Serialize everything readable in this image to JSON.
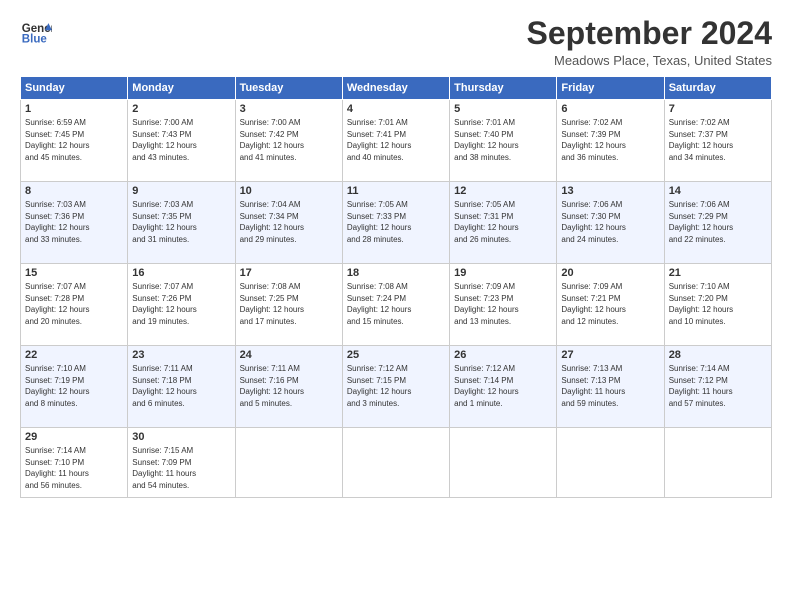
{
  "header": {
    "logo_line1": "General",
    "logo_line2": "Blue",
    "title": "September 2024",
    "location": "Meadows Place, Texas, United States"
  },
  "columns": [
    "Sunday",
    "Monday",
    "Tuesday",
    "Wednesday",
    "Thursday",
    "Friday",
    "Saturday"
  ],
  "weeks": [
    [
      {
        "day": "1",
        "info": "Sunrise: 6:59 AM\nSunset: 7:45 PM\nDaylight: 12 hours\nand 45 minutes."
      },
      {
        "day": "2",
        "info": "Sunrise: 7:00 AM\nSunset: 7:43 PM\nDaylight: 12 hours\nand 43 minutes."
      },
      {
        "day": "3",
        "info": "Sunrise: 7:00 AM\nSunset: 7:42 PM\nDaylight: 12 hours\nand 41 minutes."
      },
      {
        "day": "4",
        "info": "Sunrise: 7:01 AM\nSunset: 7:41 PM\nDaylight: 12 hours\nand 40 minutes."
      },
      {
        "day": "5",
        "info": "Sunrise: 7:01 AM\nSunset: 7:40 PM\nDaylight: 12 hours\nand 38 minutes."
      },
      {
        "day": "6",
        "info": "Sunrise: 7:02 AM\nSunset: 7:39 PM\nDaylight: 12 hours\nand 36 minutes."
      },
      {
        "day": "7",
        "info": "Sunrise: 7:02 AM\nSunset: 7:37 PM\nDaylight: 12 hours\nand 34 minutes."
      }
    ],
    [
      {
        "day": "8",
        "info": "Sunrise: 7:03 AM\nSunset: 7:36 PM\nDaylight: 12 hours\nand 33 minutes."
      },
      {
        "day": "9",
        "info": "Sunrise: 7:03 AM\nSunset: 7:35 PM\nDaylight: 12 hours\nand 31 minutes."
      },
      {
        "day": "10",
        "info": "Sunrise: 7:04 AM\nSunset: 7:34 PM\nDaylight: 12 hours\nand 29 minutes."
      },
      {
        "day": "11",
        "info": "Sunrise: 7:05 AM\nSunset: 7:33 PM\nDaylight: 12 hours\nand 28 minutes."
      },
      {
        "day": "12",
        "info": "Sunrise: 7:05 AM\nSunset: 7:31 PM\nDaylight: 12 hours\nand 26 minutes."
      },
      {
        "day": "13",
        "info": "Sunrise: 7:06 AM\nSunset: 7:30 PM\nDaylight: 12 hours\nand 24 minutes."
      },
      {
        "day": "14",
        "info": "Sunrise: 7:06 AM\nSunset: 7:29 PM\nDaylight: 12 hours\nand 22 minutes."
      }
    ],
    [
      {
        "day": "15",
        "info": "Sunrise: 7:07 AM\nSunset: 7:28 PM\nDaylight: 12 hours\nand 20 minutes."
      },
      {
        "day": "16",
        "info": "Sunrise: 7:07 AM\nSunset: 7:26 PM\nDaylight: 12 hours\nand 19 minutes."
      },
      {
        "day": "17",
        "info": "Sunrise: 7:08 AM\nSunset: 7:25 PM\nDaylight: 12 hours\nand 17 minutes."
      },
      {
        "day": "18",
        "info": "Sunrise: 7:08 AM\nSunset: 7:24 PM\nDaylight: 12 hours\nand 15 minutes."
      },
      {
        "day": "19",
        "info": "Sunrise: 7:09 AM\nSunset: 7:23 PM\nDaylight: 12 hours\nand 13 minutes."
      },
      {
        "day": "20",
        "info": "Sunrise: 7:09 AM\nSunset: 7:21 PM\nDaylight: 12 hours\nand 12 minutes."
      },
      {
        "day": "21",
        "info": "Sunrise: 7:10 AM\nSunset: 7:20 PM\nDaylight: 12 hours\nand 10 minutes."
      }
    ],
    [
      {
        "day": "22",
        "info": "Sunrise: 7:10 AM\nSunset: 7:19 PM\nDaylight: 12 hours\nand 8 minutes."
      },
      {
        "day": "23",
        "info": "Sunrise: 7:11 AM\nSunset: 7:18 PM\nDaylight: 12 hours\nand 6 minutes."
      },
      {
        "day": "24",
        "info": "Sunrise: 7:11 AM\nSunset: 7:16 PM\nDaylight: 12 hours\nand 5 minutes."
      },
      {
        "day": "25",
        "info": "Sunrise: 7:12 AM\nSunset: 7:15 PM\nDaylight: 12 hours\nand 3 minutes."
      },
      {
        "day": "26",
        "info": "Sunrise: 7:12 AM\nSunset: 7:14 PM\nDaylight: 12 hours\nand 1 minute."
      },
      {
        "day": "27",
        "info": "Sunrise: 7:13 AM\nSunset: 7:13 PM\nDaylight: 11 hours\nand 59 minutes."
      },
      {
        "day": "28",
        "info": "Sunrise: 7:14 AM\nSunset: 7:12 PM\nDaylight: 11 hours\nand 57 minutes."
      }
    ],
    [
      {
        "day": "29",
        "info": "Sunrise: 7:14 AM\nSunset: 7:10 PM\nDaylight: 11 hours\nand 56 minutes."
      },
      {
        "day": "30",
        "info": "Sunrise: 7:15 AM\nSunset: 7:09 PM\nDaylight: 11 hours\nand 54 minutes."
      },
      {
        "day": "",
        "info": ""
      },
      {
        "day": "",
        "info": ""
      },
      {
        "day": "",
        "info": ""
      },
      {
        "day": "",
        "info": ""
      },
      {
        "day": "",
        "info": ""
      }
    ]
  ]
}
